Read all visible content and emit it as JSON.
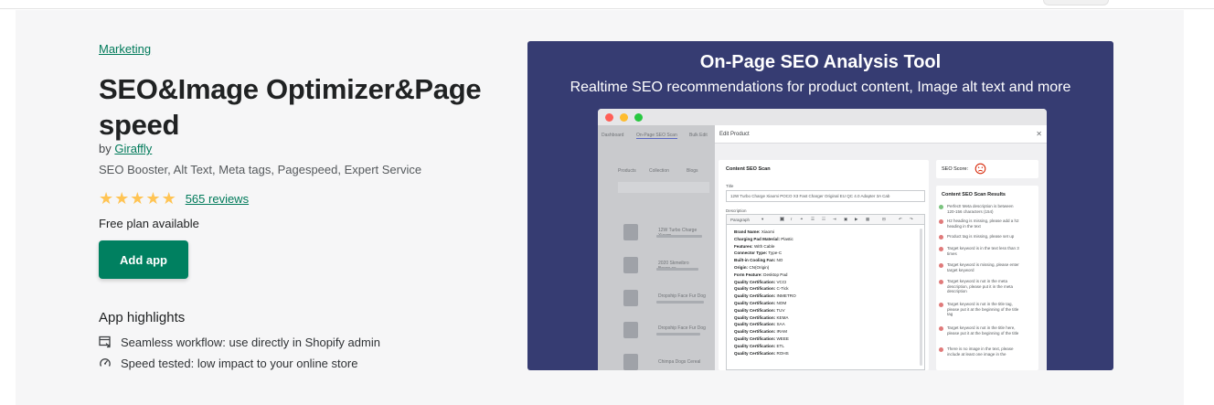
{
  "app": {
    "category": "Marketing",
    "title": "SEO&Image Optimizer&Page speed",
    "by_prefix": "by",
    "developer": "Giraffly",
    "tagline": "SEO Booster, Alt Text, Meta tags, Pagespeed, Expert Service",
    "rating_stars": 5,
    "reviews_label": "565 reviews",
    "pricing": "Free plan available",
    "add_button": "Add app"
  },
  "highlights": {
    "title": "App highlights",
    "items": [
      {
        "icon": "workflow-icon",
        "label": "Seamless workflow: use directly in Shopify admin"
      },
      {
        "icon": "speed-icon",
        "label": "Speed tested: low impact to your online store"
      }
    ]
  },
  "screenshot": {
    "title": "On-Page SEO Analysis Tool",
    "subtitle": "Realtime SEO recommendations for product content, Image alt text and more",
    "background": "#363c72",
    "bg_tabs": [
      "Dashboard",
      "On-Page SEO Scan",
      "Bulk Edit"
    ],
    "bg_subtabs": [
      "Products",
      "Collection",
      "Blogs"
    ],
    "bg_rows": [
      "12W Turbo Charge Xiaom",
      "2020 Skmeibro Brosp.cc",
      "Dropship Face Fur Dog",
      "Dropship Face Fur Dog",
      "Chimpa Dogs Cereal"
    ],
    "modal": {
      "header": "Edit Product",
      "content_card_title": "Content SEO Scan",
      "title_label": "Title",
      "title_value": "12W Turbo Charge Xiaomi POCO X3 Fast Charger Original EU QC 4.0 Adapter 3A Cab",
      "description_label": "Description",
      "toolbar_format": "Paragraph",
      "specs": [
        {
          "k": "Brand Name:",
          "v": "Xiaomi"
        },
        {
          "k": "Charging Pad Material:",
          "v": "Plastic"
        },
        {
          "k": "Features:",
          "v": "With Cable"
        },
        {
          "k": "Connector Type:",
          "v": "Type-C"
        },
        {
          "k": "Built-in Cooling Fan:",
          "v": "NO"
        },
        {
          "k": "Origin:",
          "v": "CN(Origin)"
        },
        {
          "k": "Form Feature:",
          "v": "Desktop Pad"
        },
        {
          "k": "Quality Certification:",
          "v": "VCCI"
        },
        {
          "k": "Quality Certification:",
          "v": "C-Tick"
        },
        {
          "k": "Quality Certification:",
          "v": "INMETRO"
        },
        {
          "k": "Quality Certification:",
          "v": "NOM"
        },
        {
          "k": "Quality Certification:",
          "v": "TUV"
        },
        {
          "k": "Quality Certification:",
          "v": "KEMA"
        },
        {
          "k": "Quality Certification:",
          "v": "SAA"
        },
        {
          "k": "Quality Certification:",
          "v": "IRAM"
        },
        {
          "k": "Quality Certification:",
          "v": "WEEE"
        },
        {
          "k": "Quality Certification:",
          "v": "ETL"
        },
        {
          "k": "Quality Certification:",
          "v": "ROHS"
        }
      ],
      "score_label": "SEO Score:",
      "results_title": "Content SEO Scan Results",
      "results": [
        {
          "status": "pass",
          "text": "Perfect! Meta description is between 120-156 characters (154)"
        },
        {
          "status": "fail",
          "text": "H2 heading is missing, please add a h2 heading in the text"
        },
        {
          "status": "fail",
          "text": "Product tag is missing, please set up"
        },
        {
          "status": "fail",
          "text": "Target keyword is in the text less than 3 times"
        },
        {
          "status": "fail",
          "text": "Target keyword is missing, please enter target keyword"
        },
        {
          "status": "fail",
          "text": "Target keyword is not in the meta description, please put it in the meta description"
        },
        {
          "status": "fail",
          "text": "Target keyword is not in the title tag, please put it at the beginning of the title tag"
        },
        {
          "status": "fail",
          "text": "Target keyword is not in the title here, please put it at the beginning of the title"
        },
        {
          "status": "fail",
          "text": "There is no image in the text, please include at least one image in the"
        }
      ]
    }
  },
  "colors": {
    "accent": "#008060",
    "link": "#007a5a",
    "star": "#ffc454",
    "pass": "#7bc47f",
    "fail": "#e07a7a",
    "score_face": "#d82c0d"
  }
}
